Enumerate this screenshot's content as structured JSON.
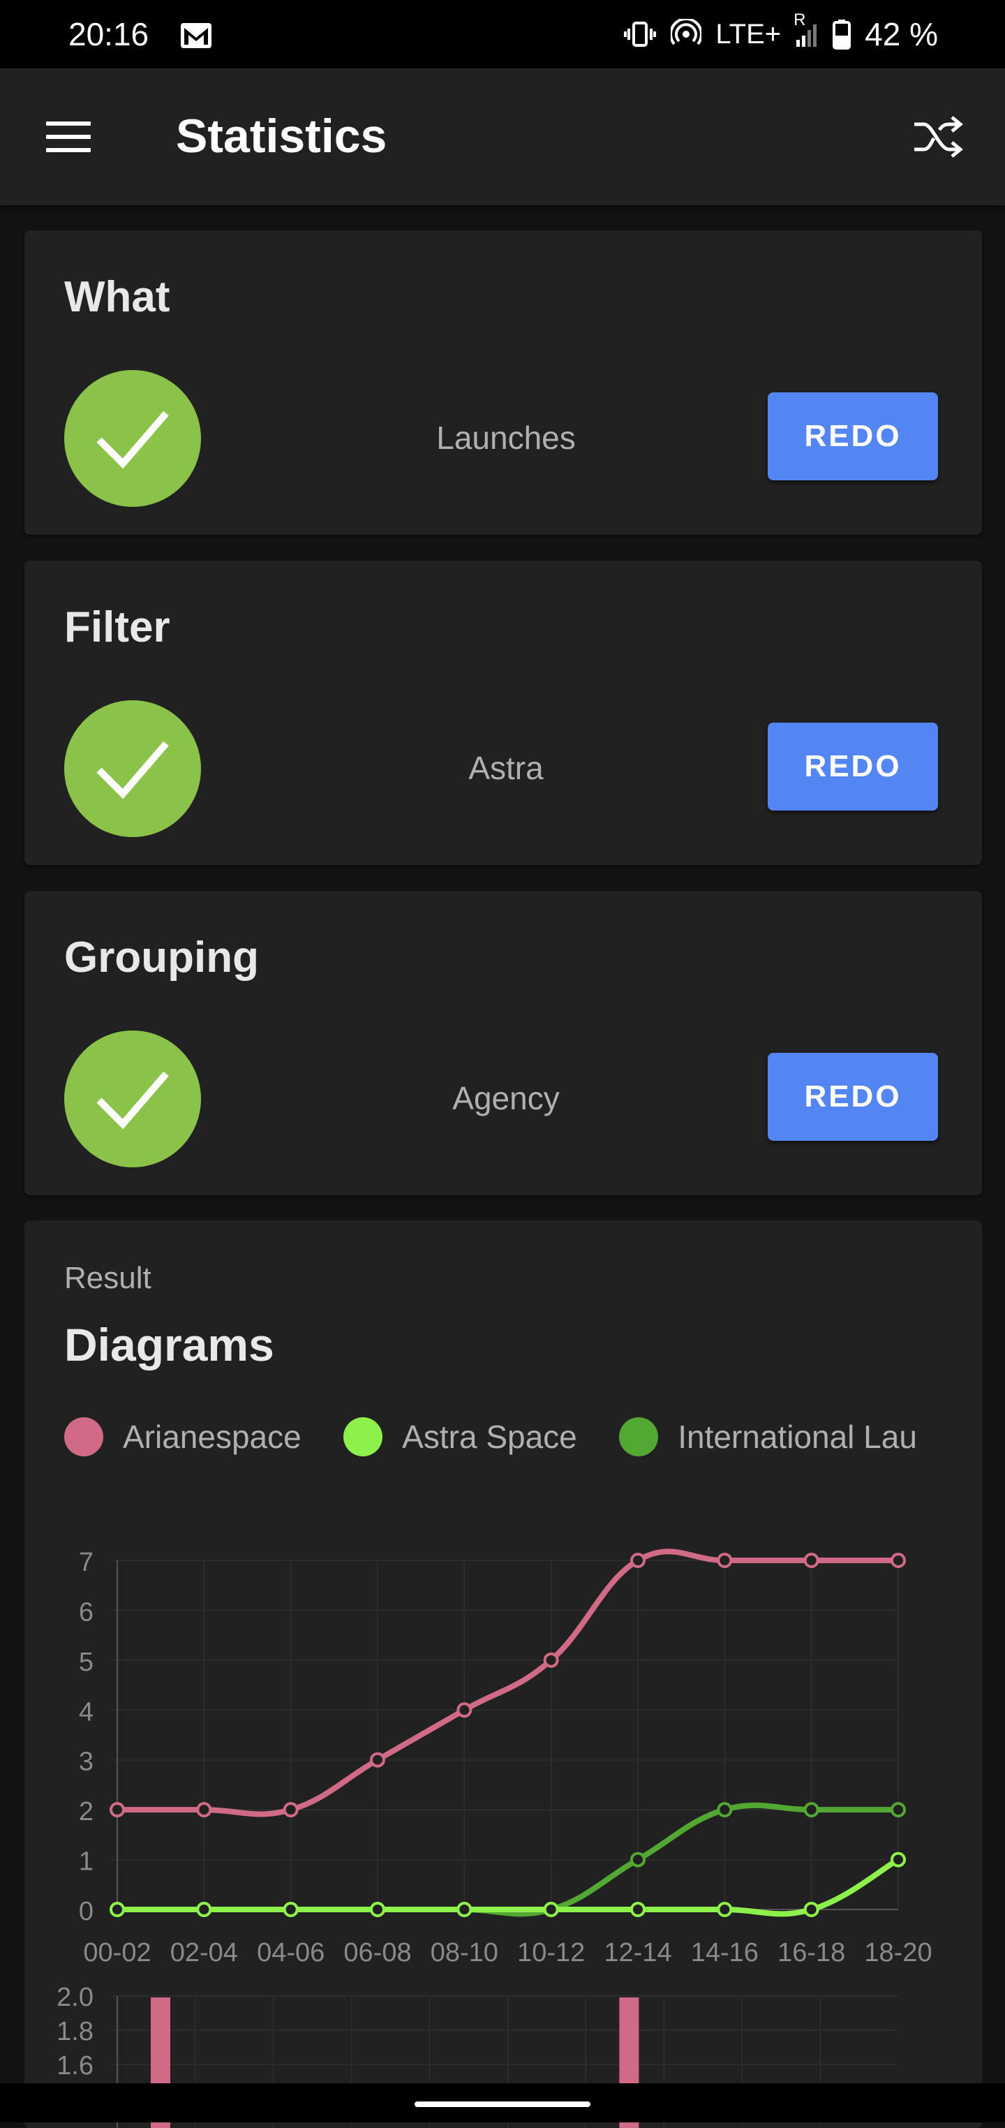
{
  "status_bar": {
    "time": "20:16",
    "network": "LTE+",
    "roaming": "R",
    "battery": "42 %"
  },
  "app_bar": {
    "title": "Statistics"
  },
  "cards": [
    {
      "title": "What",
      "value": "Launches",
      "button": "REDO"
    },
    {
      "title": "Filter",
      "value": "Astra",
      "button": "REDO"
    },
    {
      "title": "Grouping",
      "value": "Agency",
      "button": "REDO"
    }
  ],
  "result": {
    "subtitle": "Result",
    "title": "Diagrams"
  },
  "colors": {
    "arianespace": "#d06a86",
    "astra": "#8ef04a",
    "international": "#52a832",
    "check": "#8bc34a",
    "button": "#5386f2"
  },
  "chart_data": [
    {
      "type": "line",
      "categories": [
        "00-02",
        "02-04",
        "04-06",
        "06-08",
        "08-10",
        "10-12",
        "12-14",
        "14-16",
        "16-18",
        "18-20"
      ],
      "series": [
        {
          "name": "Arianespace",
          "values": [
            2,
            2,
            2,
            3,
            4,
            5,
            7,
            7,
            7,
            7
          ]
        },
        {
          "name": "Astra Space",
          "values": [
            0,
            0,
            0,
            0,
            0,
            0,
            0,
            0,
            0,
            1
          ]
        },
        {
          "name": "International Lau",
          "values": [
            0,
            0,
            0,
            0,
            0,
            0,
            1,
            2,
            2,
            2
          ]
        }
      ],
      "ylim": [
        0,
        7
      ],
      "yticks": [
        "0",
        "1",
        "2",
        "3",
        "4",
        "5",
        "6",
        "7"
      ],
      "grid": true,
      "legend": "top"
    },
    {
      "type": "bar",
      "yticks_visible": [
        "1.6",
        "1.8",
        "2.0"
      ],
      "ylim_top": 2.0,
      "bars_visible": [
        {
          "series": "Arianespace",
          "slot": 0
        },
        {
          "series": "Arianespace",
          "slot": 6
        }
      ]
    }
  ]
}
